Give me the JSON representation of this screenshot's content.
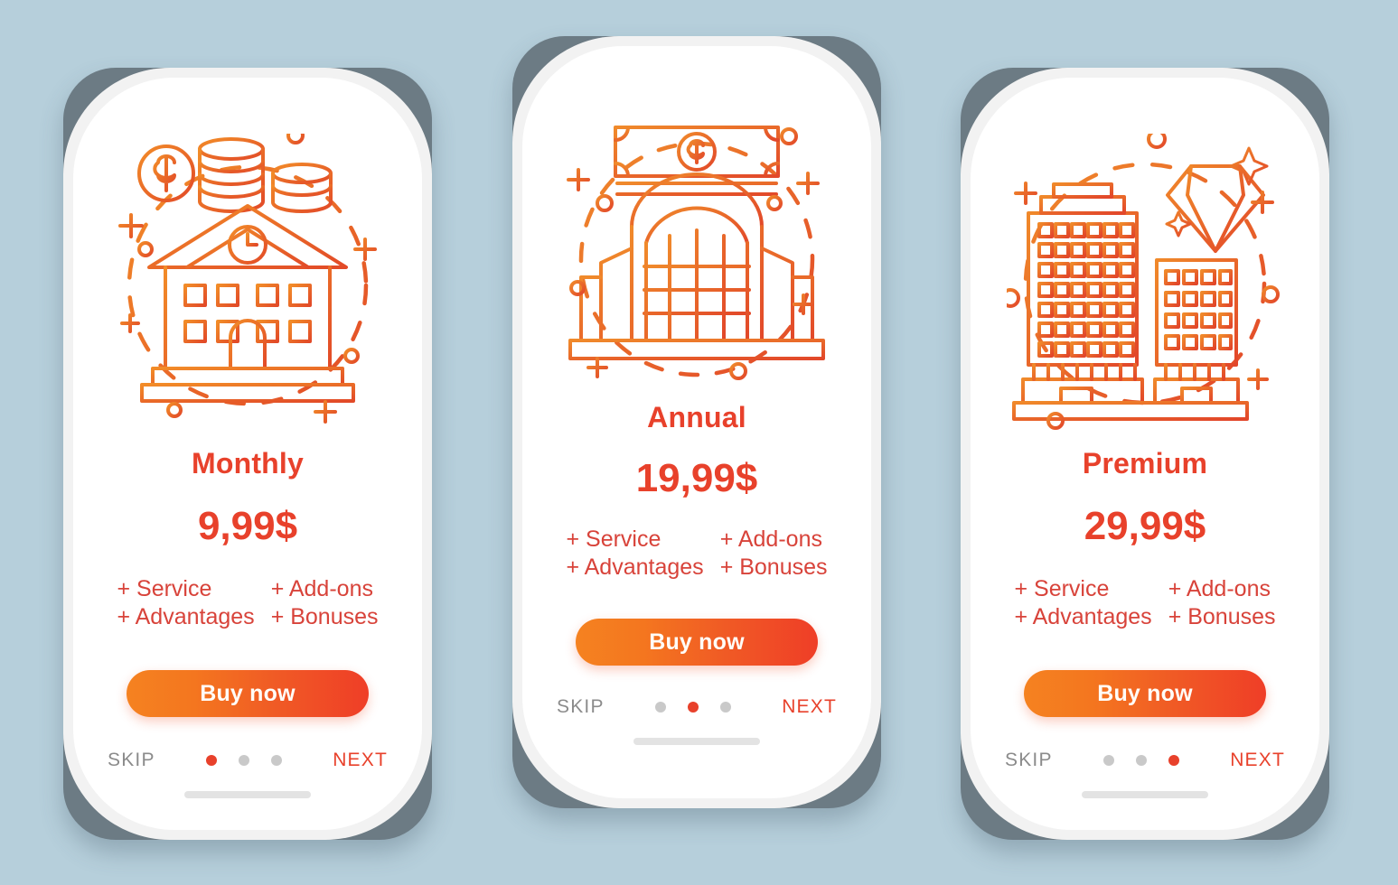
{
  "background_color": "#b6cfdb",
  "theme": {
    "accent_red": "#e8412b",
    "feature_red": "#d8433a",
    "gradient_start": "#f58220",
    "gradient_end": "#ef3e27",
    "skip_gray": "#8b8b8b",
    "dot_inactive": "#c9c9c9",
    "frame_slate": "#6c7b84"
  },
  "screens": [
    {
      "illustration": "house-with-coins-icon",
      "title": "Monthly",
      "price": "9,99$",
      "features": [
        "+ Service",
        "+ Add-ons",
        "+ Advantages",
        "+ Bonuses"
      ],
      "buy_label": "Buy now",
      "skip_label": "SKIP",
      "next_label": "NEXT",
      "dots": 3,
      "active_dot": 0
    },
    {
      "illustration": "bank-building-with-banknotes-icon",
      "title": "Annual",
      "price": "19,99$",
      "features": [
        "+ Service",
        "+ Add-ons",
        "+ Advantages",
        "+ Bonuses"
      ],
      "buy_label": "Buy now",
      "skip_label": "SKIP",
      "next_label": "NEXT",
      "dots": 3,
      "active_dot": 1
    },
    {
      "illustration": "office-towers-with-diamond-icon",
      "title": "Premium",
      "price": "29,99$",
      "features": [
        "+ Service",
        "+ Add-ons",
        "+ Advantages",
        "+ Bonuses"
      ],
      "buy_label": "Buy now",
      "skip_label": "SKIP",
      "next_label": "NEXT",
      "dots": 3,
      "active_dot": 2
    }
  ]
}
